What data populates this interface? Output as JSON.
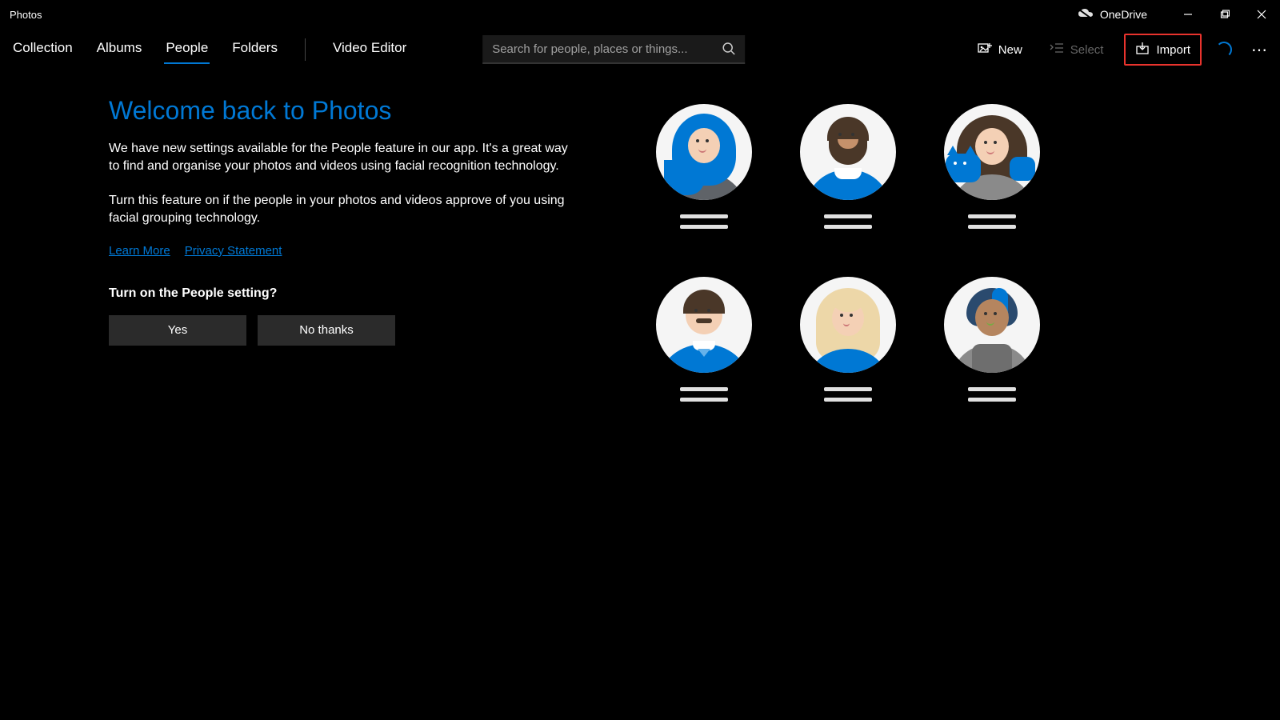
{
  "app_title": "Photos",
  "onedrive_label": "OneDrive",
  "nav": {
    "items": [
      "Collection",
      "Albums",
      "People",
      "Folders",
      "Video Editor"
    ],
    "active_index": 2
  },
  "search": {
    "placeholder": "Search for people, places or things..."
  },
  "toolbar": {
    "new_label": "New",
    "select_label": "Select",
    "import_label": "Import"
  },
  "welcome": {
    "title": "Welcome back to Photos",
    "p1": "We have new settings available for the People feature in our app. It's a great way to find and organise your photos and videos using facial recognition technology.",
    "p2": "Turn this feature on if the people in your photos and videos approve of you using facial grouping technology.",
    "learn_more": "Learn More",
    "privacy": "Privacy Statement",
    "prompt": "Turn on the People setting?",
    "yes": "Yes",
    "no": "No thanks"
  }
}
